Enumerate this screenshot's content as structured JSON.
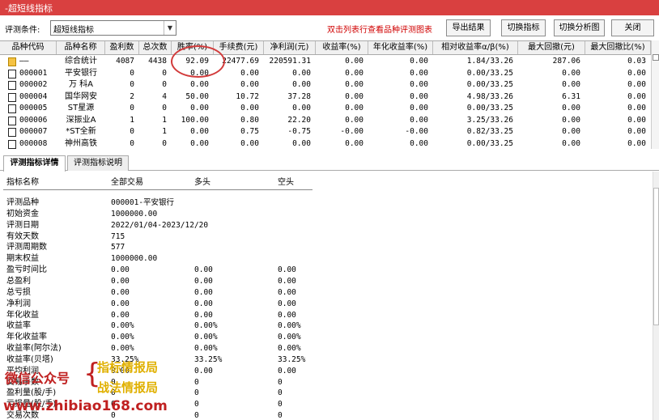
{
  "window": {
    "title": "-超短线指标"
  },
  "toolbar": {
    "condition_label": "评测条件:",
    "condition_value": "超短线指标",
    "hint": "双击列表行查看品种评测图表",
    "export_label": "导出结果",
    "switch_indicator_label": "切换指标",
    "switch_chart_label": "切换分析图",
    "close_label": "关闭"
  },
  "grid": {
    "columns": [
      "品种代码",
      "品种名称",
      "盈利数",
      "总次数",
      "胜率(%)",
      "手续费(元)",
      "净利润(元)",
      "收益率(%)",
      "年化收益率(%)",
      "相对收益率α/β(%)",
      "最大回撤(元)",
      "最大回撤比(%)"
    ],
    "rows": [
      {
        "code": "——",
        "name": "综合统计",
        "win": "4087",
        "total": "4438",
        "rate": "92.09",
        "fee": "22477.69",
        "profit": "220591.31",
        "ret": "0.00",
        "annual": "0.00",
        "rel": "1.84/33.26",
        "dd": "287.06",
        "ddr": "0.03"
      },
      {
        "code": "000001",
        "name": "平安银行",
        "win": "0",
        "total": "0",
        "rate": "0.00",
        "fee": "0.00",
        "profit": "0.00",
        "ret": "0.00",
        "annual": "0.00",
        "rel": "0.00/33.25",
        "dd": "0.00",
        "ddr": "0.00"
      },
      {
        "code": "000002",
        "name": "万 科A",
        "win": "0",
        "total": "0",
        "rate": "0.00",
        "fee": "0.00",
        "profit": "0.00",
        "ret": "0.00",
        "annual": "0.00",
        "rel": "0.00/33.25",
        "dd": "0.00",
        "ddr": "0.00"
      },
      {
        "code": "000004",
        "name": "国华网安",
        "win": "2",
        "total": "4",
        "rate": "50.00",
        "fee": "10.72",
        "profit": "37.28",
        "ret": "0.00",
        "annual": "0.00",
        "rel": "4.98/33.26",
        "dd": "6.31",
        "ddr": "0.00"
      },
      {
        "code": "000005",
        "name": "ST星源",
        "win": "0",
        "total": "0",
        "rate": "0.00",
        "fee": "0.00",
        "profit": "0.00",
        "ret": "0.00",
        "annual": "0.00",
        "rel": "0.00/33.25",
        "dd": "0.00",
        "ddr": "0.00"
      },
      {
        "code": "000006",
        "name": "深振业A",
        "win": "1",
        "total": "1",
        "rate": "100.00",
        "fee": "0.80",
        "profit": "22.20",
        "ret": "0.00",
        "annual": "0.00",
        "rel": "3.25/33.26",
        "dd": "0.00",
        "ddr": "0.00"
      },
      {
        "code": "000007",
        "name": "*ST全新",
        "win": "0",
        "total": "1",
        "rate": "0.00",
        "fee": "0.75",
        "profit": "-0.75",
        "ret": "-0.00",
        "annual": "-0.00",
        "rel": "0.82/33.25",
        "dd": "0.00",
        "ddr": "0.00"
      },
      {
        "code": "000008",
        "name": "神州高铁",
        "win": "0",
        "total": "0",
        "rate": "0.00",
        "fee": "0.00",
        "profit": "0.00",
        "ret": "0.00",
        "annual": "0.00",
        "rel": "0.00/33.25",
        "dd": "0.00",
        "ddr": "0.00"
      }
    ]
  },
  "tabs": [
    {
      "label": "评测指标详情"
    },
    {
      "label": "评测指标说明"
    }
  ],
  "detail": {
    "headers": [
      "指标名称",
      "全部交易",
      "多头",
      "空头"
    ],
    "rows": [
      {
        "name": "评测品种",
        "all": "000001-平安银行",
        "long": "",
        "short": ""
      },
      {
        "name": "初始资金",
        "all": "1000000.00",
        "long": "",
        "short": ""
      },
      {
        "name": "评测日期",
        "all": "2022/01/04-2023/12/20",
        "long": "",
        "short": ""
      },
      {
        "name": "有效天数",
        "all": "715",
        "long": "",
        "short": ""
      },
      {
        "name": "评测周期数",
        "all": "577",
        "long": "",
        "short": ""
      },
      {
        "name": "期末权益",
        "all": "1000000.00",
        "long": "",
        "short": ""
      },
      {
        "name": "盈亏时间比",
        "all": "0.00",
        "long": "0.00",
        "short": "0.00"
      },
      {
        "name": "总盈利",
        "all": "0.00",
        "long": "0.00",
        "short": "0.00"
      },
      {
        "name": "总亏损",
        "all": "0.00",
        "long": "0.00",
        "short": "0.00"
      },
      {
        "name": "净利润",
        "all": "0.00",
        "long": "0.00",
        "short": "0.00"
      },
      {
        "name": "年化收益",
        "all": "0.00",
        "long": "0.00",
        "short": "0.00"
      },
      {
        "name": "收益率",
        "all": "0.00%",
        "long": "0.00%",
        "short": "0.00%"
      },
      {
        "name": "年化收益率",
        "all": "0.00%",
        "long": "0.00%",
        "short": "0.00%"
      },
      {
        "name": "收益率(阿尔法)",
        "all": "0.00%",
        "long": "0.00%",
        "short": "0.00%"
      },
      {
        "name": "收益率(贝塔)",
        "all": "33.25%",
        "long": "33.25%",
        "short": "33.25%"
      },
      {
        "name": "平均利润",
        "all": "0.00",
        "long": "0.00",
        "short": "0.00"
      },
      {
        "name": "交易手数",
        "all": "0",
        "long": "0",
        "short": "0"
      },
      {
        "name": "盈利量(股/手)",
        "all": "0",
        "long": "0",
        "short": "0"
      },
      {
        "name": "亏损量(股/手)",
        "all": "0",
        "long": "0",
        "short": "0"
      },
      {
        "name": "交易次数",
        "all": "0",
        "long": "0",
        "short": "0"
      }
    ]
  },
  "watermark": {
    "line1": "微信公众号",
    "brace": "{",
    "line2": "指标情报局",
    "line3": "战法情报局",
    "line4": "www.zhibiao168.com"
  }
}
